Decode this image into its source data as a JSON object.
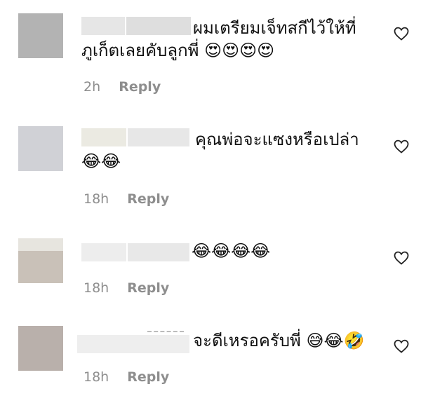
{
  "comments": [
    {
      "text_line1": "ผมเตรียมเจ็ทสกีไว้ให้ที่",
      "text_line2": "ภูเก็ตเลยคับลูกพี่ 😍😍😍😍",
      "time": "2h",
      "reply": "Reply"
    },
    {
      "text_line1": "คุณพ่อจะแซงหรือเปล่า",
      "text_line2": "😂😂",
      "time": "18h",
      "reply": "Reply"
    },
    {
      "text_line1": "😂😂😂😂",
      "time": "18h",
      "reply": "Reply"
    },
    {
      "text_line1": "จะดีเหรอครับพี่ 😅😂🤣",
      "time": "18h",
      "reply": "Reply"
    }
  ],
  "icons": {
    "like": "heart-outline-icon"
  },
  "colors": {
    "meta": "#8e8e8e",
    "text": "#111111",
    "avatar1": "#b3b3b3",
    "avatar2": "#d0d1d6",
    "avatar3": "#c9c1b8",
    "avatar4": "#b9b0ab"
  }
}
